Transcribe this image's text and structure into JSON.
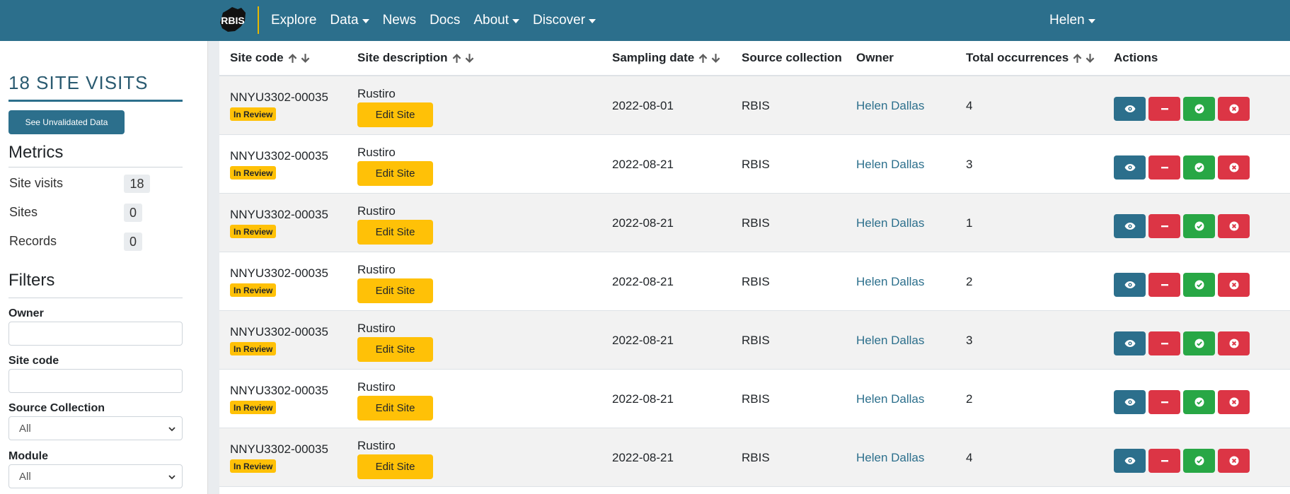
{
  "navbar": {
    "brand": "RBIS",
    "links": [
      {
        "label": "Explore",
        "dropdown": false
      },
      {
        "label": "Data",
        "dropdown": true
      },
      {
        "label": "News",
        "dropdown": false
      },
      {
        "label": "Docs",
        "dropdown": false
      },
      {
        "label": "About",
        "dropdown": true
      },
      {
        "label": "Discover",
        "dropdown": true
      }
    ],
    "user": "Helen"
  },
  "sidebar": {
    "title": "18 SITE VISITS",
    "unvalidated_button": "See Unvalidated Data",
    "metrics_heading": "Metrics",
    "metrics": [
      {
        "label": "Site visits",
        "value": "18"
      },
      {
        "label": "Sites",
        "value": "0"
      },
      {
        "label": "Records",
        "value": "0"
      }
    ],
    "filters_heading": "Filters",
    "filters": {
      "owner_label": "Owner",
      "owner_value": "",
      "site_code_label": "Site code",
      "site_code_value": "",
      "source_collection_label": "Source Collection",
      "source_collection_value": "All",
      "module_label": "Module",
      "module_value": "All"
    }
  },
  "table": {
    "columns": {
      "site_code": "Site code",
      "site_description": "Site description",
      "sampling_date": "Sampling date",
      "source_collection": "Source collection",
      "owner": "Owner",
      "total_occurrences": "Total occurrences",
      "actions": "Actions"
    },
    "status_label": "In Review",
    "edit_label": "Edit Site",
    "rows": [
      {
        "site_code": "NNYU3302-00035",
        "description": "Rustiro",
        "date": "2022-08-01",
        "source": "RBIS",
        "owner": "Helen Dallas",
        "occurrences": "4"
      },
      {
        "site_code": "NNYU3302-00035",
        "description": "Rustiro",
        "date": "2022-08-21",
        "source": "RBIS",
        "owner": "Helen Dallas",
        "occurrences": "3"
      },
      {
        "site_code": "NNYU3302-00035",
        "description": "Rustiro",
        "date": "2022-08-21",
        "source": "RBIS",
        "owner": "Helen Dallas",
        "occurrences": "1"
      },
      {
        "site_code": "NNYU3302-00035",
        "description": "Rustiro",
        "date": "2022-08-21",
        "source": "RBIS",
        "owner": "Helen Dallas",
        "occurrences": "2"
      },
      {
        "site_code": "NNYU3302-00035",
        "description": "Rustiro",
        "date": "2022-08-21",
        "source": "RBIS",
        "owner": "Helen Dallas",
        "occurrences": "3"
      },
      {
        "site_code": "NNYU3302-00035",
        "description": "Rustiro",
        "date": "2022-08-21",
        "source": "RBIS",
        "owner": "Helen Dallas",
        "occurrences": "2"
      },
      {
        "site_code": "NNYU3302-00035",
        "description": "Rustiro",
        "date": "2022-08-21",
        "source": "RBIS",
        "owner": "Helen Dallas",
        "occurrences": "4"
      }
    ]
  },
  "colors": {
    "primary": "#2c6f8c",
    "warning": "#ffc107",
    "danger": "#dc3545",
    "success": "#28a745"
  }
}
